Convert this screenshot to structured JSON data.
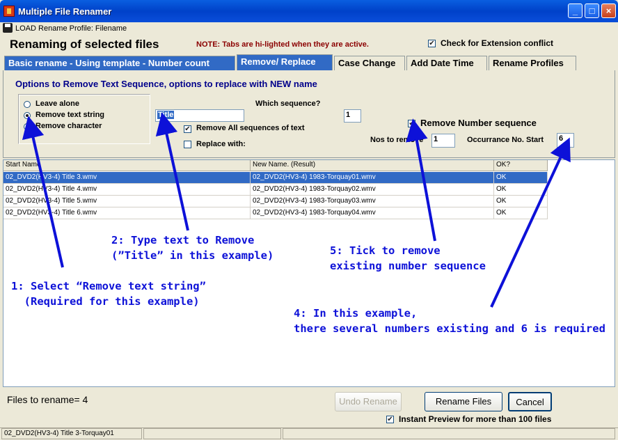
{
  "window": {
    "title": "Multiple File Renamer",
    "minimize_label": "_",
    "maximize_label": "□",
    "close_label": "×"
  },
  "menubar": {
    "load_profile": "LOAD Rename Profile: Filename"
  },
  "header": {
    "title": "Renaming of selected files",
    "note": "NOTE: Tabs are hi-lighted when they are active.",
    "extension_check_label": "Check for Extension conflict",
    "extension_check_mark": "✔"
  },
  "tabs": [
    {
      "label": "Basic rename - Using template - Number count"
    },
    {
      "label": "Remove/ Replace"
    },
    {
      "label": "Case Change"
    },
    {
      "label": "Add Date Time"
    },
    {
      "label": "Rename Profiles"
    }
  ],
  "panel": {
    "title": "Options to Remove Text Sequence, options to replace with NEW name",
    "radios": [
      {
        "label": "Leave alone"
      },
      {
        "label": "Remove text string"
      },
      {
        "label": "Remove character"
      }
    ],
    "text_to_remove": "Title",
    "which_sequence_label": "Which sequence?",
    "which_sequence_value": "1",
    "remove_all_label": "Remove All sequences of text",
    "remove_all_mark": "✔",
    "replace_with_label": "Replace with:",
    "remove_number_label": "Remove Number sequence",
    "remove_number_mark": "✔",
    "nos_to_remove_label": "Nos to remove",
    "nos_to_remove_value": "1",
    "occurrence_label": "Occurrance No. Start",
    "occurrence_value": "6"
  },
  "grid": {
    "headers": [
      "Start Name",
      "New Name. (Result)",
      "OK?"
    ],
    "rows": [
      {
        "start": "02_DVD2(HV3-4) Title 3.wmv",
        "result": "02_DVD2(HV3-4) 1983-Torquay01.wmv",
        "ok": "OK"
      },
      {
        "start": "02_DVD2(HV3-4) Title 4.wmv",
        "result": "02_DVD2(HV3-4) 1983-Torquay02.wmv",
        "ok": "OK"
      },
      {
        "start": "02_DVD2(HV3-4) Title 5.wmv",
        "result": "02_DVD2(HV3-4) 1983-Torquay03.wmv",
        "ok": "OK"
      },
      {
        "start": "02_DVD2(HV3-4) Title 6.wmv",
        "result": "02_DVD2(HV3-4) 1983-Torquay04.wmv",
        "ok": "OK"
      }
    ]
  },
  "footer": {
    "files_to_rename": "Files to rename= 4",
    "undo_label": "Undo Rename",
    "rename_label": "Rename Files",
    "cancel_label": "Cancel",
    "instant_preview_label": "Instant Preview for more than 100 files",
    "instant_preview_mark": "✔"
  },
  "statusbar": {
    "text": "02_DVD2(HV3-4) Title 3-Torquay01"
  },
  "annotations": {
    "a1": "1: Select “Remove text string”\n  (Required for this example)",
    "a2": "2: Type text to Remove\n(”Title” in this example)",
    "a4": "4: In this example,\nthere several numbers existing and 6 is required",
    "a5": "5: Tick to remove\nexisting number sequence"
  },
  "colors": {
    "annotation": "#0d11d8",
    "selection": "#316ac5",
    "note": "#8b0000"
  }
}
